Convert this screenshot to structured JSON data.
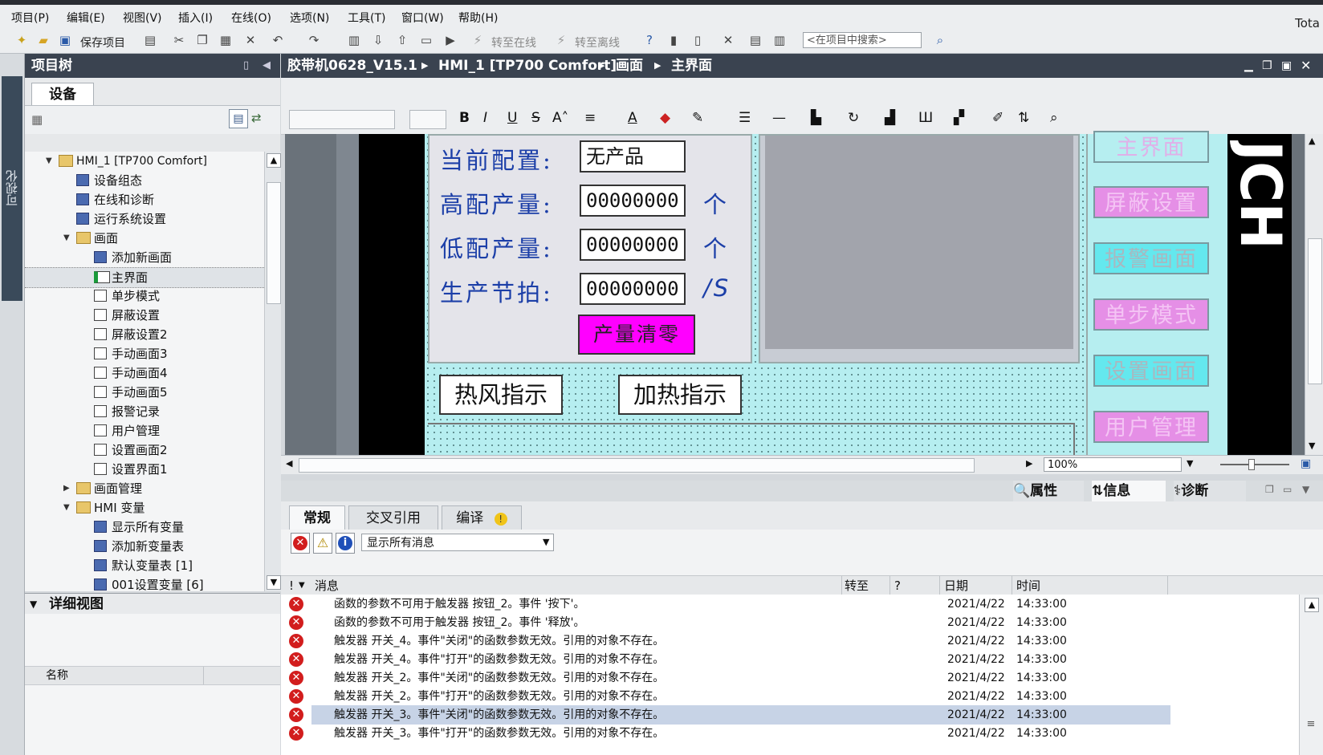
{
  "menubar": {
    "items": [
      "项目(P)",
      "编辑(E)",
      "视图(V)",
      "插入(I)",
      "在线(O)",
      "选项(N)",
      "工具(T)",
      "窗口(W)",
      "帮助(H)"
    ],
    "right_text": "Tota"
  },
  "toolbar": {
    "save_label": "保存项目",
    "go_online": "转至在线",
    "go_offline": "转至离线",
    "search_placeholder": "<在项目中搜索>"
  },
  "left_strip": {
    "label": "可视化"
  },
  "project_tree": {
    "title": "项目树",
    "tab": "设备",
    "items": [
      {
        "label": "HMI_1 [TP700 Comfort]",
        "level": 1,
        "expanded": true,
        "icon": "hmi-device-icon"
      },
      {
        "label": "设备组态",
        "level": 2,
        "icon": "device-config-icon"
      },
      {
        "label": "在线和诊断",
        "level": 2,
        "icon": "online-diag-icon"
      },
      {
        "label": "运行系统设置",
        "level": 2,
        "icon": "runtime-settings-icon"
      },
      {
        "label": "画面",
        "level": 2,
        "expanded": true,
        "icon": "folder-icon"
      },
      {
        "label": "添加新画面",
        "level": 3,
        "icon": "add-screen-icon"
      },
      {
        "label": "主界面",
        "level": 3,
        "selected": true,
        "icon": "start-screen-icon"
      },
      {
        "label": "单步模式",
        "level": 3,
        "icon": "screen-icon"
      },
      {
        "label": "屏蔽设置",
        "level": 3,
        "icon": "screen-icon"
      },
      {
        "label": "屏蔽设置2",
        "level": 3,
        "icon": "screen-icon"
      },
      {
        "label": "手动画面3",
        "level": 3,
        "icon": "screen-icon"
      },
      {
        "label": "手动画面4",
        "level": 3,
        "icon": "screen-icon"
      },
      {
        "label": "手动画面5",
        "level": 3,
        "icon": "screen-icon"
      },
      {
        "label": "报警记录",
        "level": 3,
        "icon": "screen-icon"
      },
      {
        "label": "用户管理",
        "level": 3,
        "icon": "screen-icon"
      },
      {
        "label": "设置画面2",
        "level": 3,
        "icon": "screen-icon"
      },
      {
        "label": "设置界面1",
        "level": 3,
        "icon": "screen-icon"
      },
      {
        "label": "画面管理",
        "level": 2,
        "collapsed": true,
        "icon": "folder-icon"
      },
      {
        "label": "HMI 变量",
        "level": 2,
        "expanded": true,
        "icon": "folder-icon"
      },
      {
        "label": "显示所有变量",
        "level": 3,
        "icon": "tags-icon"
      },
      {
        "label": "添加新变量表",
        "level": 3,
        "icon": "add-tagtable-icon"
      },
      {
        "label": "默认变量表 [1]",
        "level": 3,
        "icon": "tagtable-icon"
      },
      {
        "label": "001设置变量 [6]",
        "level": 3,
        "icon": "tagtable-icon"
      }
    ]
  },
  "details_view": {
    "title": "详细视图",
    "column_name": "名称"
  },
  "editor": {
    "breadcrumb": [
      "胶带机0628_V15.1",
      "HMI_1 [TP700 Comfort]",
      "画面",
      "主界面"
    ]
  },
  "screen": {
    "config_label": "当前配置:",
    "config_value": "无产品",
    "high_label": "高配产量:",
    "high_value": "00000000",
    "high_unit": "个",
    "low_label": "低配产量:",
    "low_value": "00000000",
    "low_unit": "个",
    "cycle_label": "生产节拍:",
    "cycle_value": "00000000",
    "cycle_unit": "/S",
    "clear_button": "产量清零",
    "hot_air": "热风指示",
    "heating": "加热指示",
    "nav_buttons": [
      "主界面",
      "屏蔽设置",
      "报警画面",
      "单步模式",
      "设置画面",
      "用户管理"
    ],
    "logo_text": "JCH"
  },
  "zoom": {
    "value": "100%"
  },
  "inspector": {
    "tabs": [
      "属性",
      "信息",
      "诊断"
    ],
    "active_tab": "信息",
    "subtabs": [
      "常规",
      "交叉引用",
      "编译"
    ],
    "filter_value": "显示所有消息",
    "columns": {
      "bang": "!",
      "message": "消息",
      "goto": "转至",
      "q": "?",
      "date": "日期",
      "time": "时间"
    },
    "messages": [
      {
        "text": "函数的参数不可用于触发器 按钮_2。事件 '按下'。",
        "date": "2021/4/22",
        "time": "14:33:00"
      },
      {
        "text": "函数的参数不可用于触发器 按钮_2。事件 '释放'。",
        "date": "2021/4/22",
        "time": "14:33:00"
      },
      {
        "text": "触发器 开关_4。事件\"关闭\"的函数参数无效。引用的对象不存在。",
        "date": "2021/4/22",
        "time": "14:33:00"
      },
      {
        "text": "触发器 开关_4。事件\"打开\"的函数参数无效。引用的对象不存在。",
        "date": "2021/4/22",
        "time": "14:33:00"
      },
      {
        "text": "触发器 开关_2。事件\"关闭\"的函数参数无效。引用的对象不存在。",
        "date": "2021/4/22",
        "time": "14:33:00"
      },
      {
        "text": "触发器 开关_2。事件\"打开\"的函数参数无效。引用的对象不存在。",
        "date": "2021/4/22",
        "time": "14:33:00"
      },
      {
        "text": "触发器 开关_3。事件\"关闭\"的函数参数无效。引用的对象不存在。",
        "date": "2021/4/22",
        "time": "14:33:00",
        "selected": true
      },
      {
        "text": "触发器 开关_3。事件\"打开\"的函数参数无效。引用的对象不存在。",
        "date": "2021/4/22",
        "time": "14:33:00"
      }
    ]
  },
  "colors": {
    "title_bar": "#3a4350",
    "cyan_panel": "#b6eef0",
    "label_blue": "#1c3fa8",
    "magenta_button": "#ff00ff",
    "error_red": "#d21d1d",
    "selection": "#c7d3e6"
  }
}
